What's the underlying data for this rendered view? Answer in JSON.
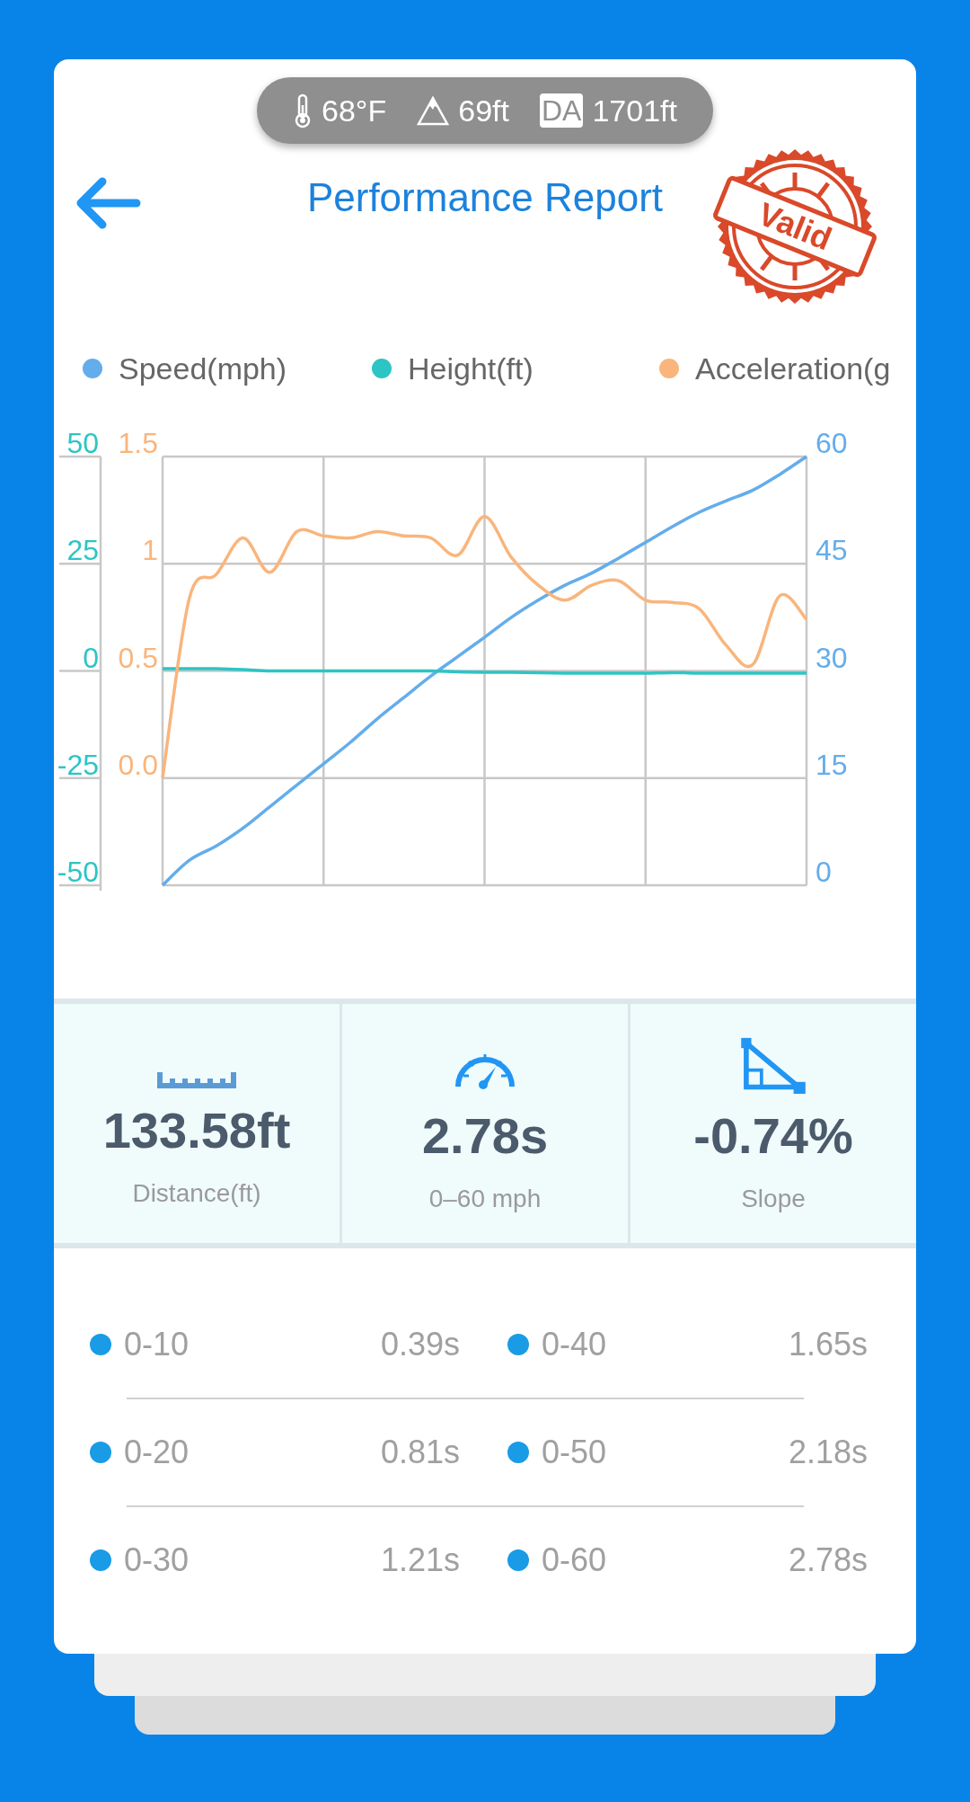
{
  "status_pill": {
    "items": [
      {
        "kind": "temperature",
        "text": "68°F"
      },
      {
        "kind": "altitude",
        "text": "69ft"
      },
      {
        "kind": "density_altitude",
        "badge": "DA",
        "text": "1701ft"
      }
    ]
  },
  "header": {
    "title": "Performance Report",
    "stamp": "Valid"
  },
  "chart": {
    "chart_data": {
      "type": "line",
      "grid": true,
      "ylim": [
        -50,
        50
      ],
      "yticks": [
        {
          "value": 50,
          "label": "50"
        },
        {
          "value": 25,
          "label": "25"
        },
        {
          "value": 0,
          "label": "0"
        },
        {
          "value": -25,
          "label": "-25"
        },
        {
          "value": -50,
          "label": "-50"
        }
      ],
      "y2lim": [
        0,
        60
      ],
      "y2ticks": [
        {
          "value": 60,
          "label": "60"
        },
        {
          "value": 45,
          "label": "45"
        },
        {
          "value": 30,
          "label": "30"
        },
        {
          "value": 15,
          "label": "15"
        },
        {
          "value": 0,
          "label": "0"
        }
      ],
      "y3lim": [
        -0.5,
        1.5
      ],
      "y3ticks": [
        {
          "value": 1.5,
          "label": "1.5"
        },
        {
          "value": 1,
          "label": "1"
        },
        {
          "value": 0.5,
          "label": "0.5"
        },
        {
          "value": 0,
          "label": "0.0"
        }
      ],
      "series": [
        {
          "name": "Speed(mph)",
          "color": "#64adeb",
          "axis": "y2",
          "values": [
            0,
            3.5,
            5.5,
            8,
            11,
            14,
            17,
            20,
            23.3,
            26.3,
            29.3,
            32,
            34.7,
            37.5,
            39.9,
            42,
            43.7,
            45.8,
            48,
            50.2,
            52.2,
            53.8,
            55.3,
            57.5,
            60
          ]
        },
        {
          "name": "Height(ft)",
          "color": "#2ec4c4",
          "values": [
            0.5,
            0.5,
            0.5,
            0.3,
            0,
            0,
            0,
            0,
            0,
            0,
            0,
            -0.2,
            -0.3,
            -0.3,
            -0.4,
            -0.5,
            -0.5,
            -0.5,
            -0.5,
            -0.4,
            -0.5,
            -0.5,
            -0.5,
            -0.5,
            -0.5
          ]
        },
        {
          "name": "Acceleration(g",
          "color": "#f9b57c",
          "axis": "y3",
          "values": [
            0,
            0.84,
            0.95,
            1.12,
            0.96,
            1.15,
            1.13,
            1.12,
            1.15,
            1.13,
            1.12,
            1.04,
            1.22,
            1.03,
            0.9,
            0.83,
            0.9,
            0.92,
            0.83,
            0.82,
            0.79,
            0.62,
            0.53,
            0.85,
            0.74
          ]
        }
      ]
    }
  },
  "stats": [
    {
      "kind": "distance",
      "value": "133.58ft",
      "label": "Distance(ft)"
    },
    {
      "kind": "speedometer",
      "value": "2.78s",
      "label": "0–60 mph"
    },
    {
      "kind": "slope",
      "value": "-0.74%",
      "label": "Slope"
    }
  ],
  "splits": [
    {
      "label": "0-10",
      "time": "0.39s"
    },
    {
      "label": "0-40",
      "time": "1.65s"
    },
    {
      "label": "0-20",
      "time": "0.81s"
    },
    {
      "label": "0-50",
      "time": "2.18s"
    },
    {
      "label": "0-30",
      "time": "1.21s"
    },
    {
      "label": "0-60",
      "time": "2.78s"
    }
  ]
}
